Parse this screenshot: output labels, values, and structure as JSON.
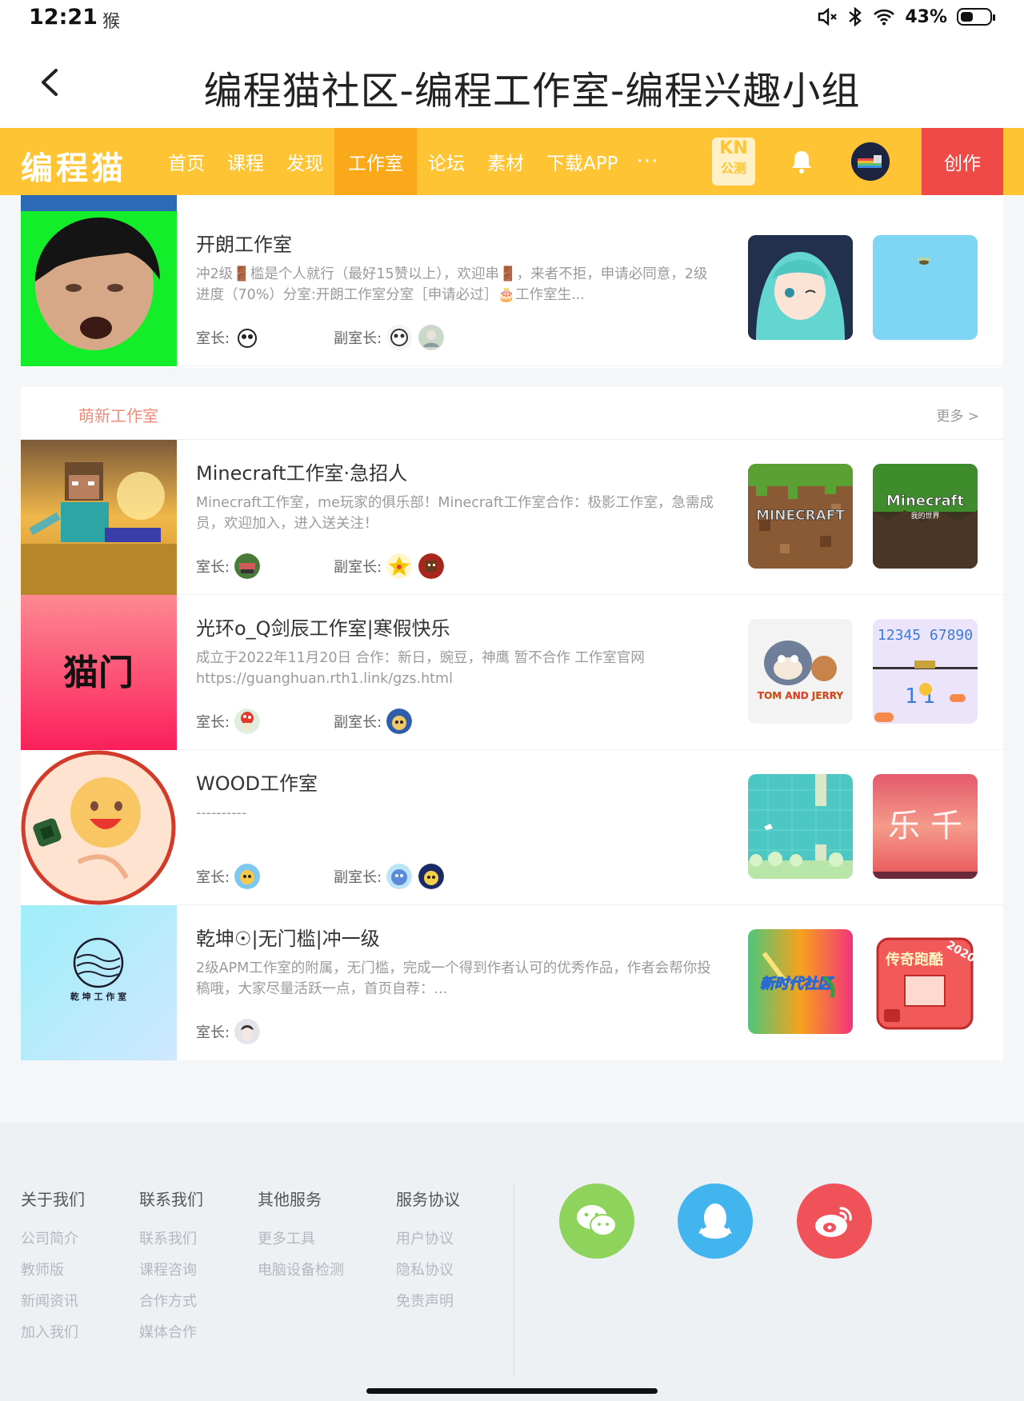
{
  "status_bar": {
    "time": "12:21",
    "app_glyph": "猴",
    "battery": "43%",
    "battery_level": 0.43
  },
  "header": {
    "title": "编程猫社区-编程工作室-编程兴趣小组"
  },
  "nav": {
    "logo": "编程猫",
    "items": [
      "首页",
      "课程",
      "发现",
      "工作室",
      "论坛",
      "素材",
      "下载APP"
    ],
    "active": "工作室",
    "more": "···",
    "badge_top": "KN",
    "badge_bottom": "公测",
    "create": "创作"
  },
  "top_studio": {
    "name": "开朗工作室",
    "desc": "冲2级🚪槛是个人就行（最好15赞以上），欢迎串🚪，来者不拒，申请必同意，2级进度（70%）分室:开朗工作室分室［申请必过］🎂工作室生...",
    "leader_label": "室长:",
    "vice_label": "副室长:"
  },
  "section": {
    "title": "萌新工作室",
    "more": "更多 >",
    "studios": [
      {
        "name": "Minecraft工作室·急招人",
        "desc": "Minecraft工作室，me玩家的俱乐部！Minecraft工作室合作：极影工作室，急需成员，欢迎加入，进入送关注！",
        "leader_label": "室长:",
        "vice_label": "副室长:",
        "work1_text": "MINECRAFT",
        "work2_text": "Minecraft",
        "work2_sub": "我的世界"
      },
      {
        "name": "光环o_Q剑辰工作室|寒假快乐",
        "desc": "成立于2022年11月20日 合作：新日，豌豆，神鹰 暂不合作 工作室官网 https://guanghuan.rth1.link/gzs.html",
        "leader_label": "室长:",
        "vice_label": "副室长:",
        "cover_text": "猫门",
        "work1_text": "TOM AND JERRY",
        "work2_text": "12345  67890"
      },
      {
        "name": "WOOD工作室",
        "desc": "----------",
        "leader_label": "室长:",
        "vice_label": "副室长:",
        "work2_text": "乐 千"
      },
      {
        "name": "乾坤☉|无门槛|冲一级",
        "desc": "2级APM工作室的附属，无门槛，完成一个得到作者认可的优秀作品，作者会帮你投稿哦，大家尽量活跃一点，首页自荐：...",
        "leader_label": "室长:",
        "cover_text": "乾 坤 工 作 室",
        "work1_text": "新时代社区",
        "work2_text": "传奇跑酷",
        "work2_sub": "2020"
      }
    ]
  },
  "footer": {
    "columns": [
      {
        "title": "关于我们",
        "links": [
          "公司简介",
          "教师版",
          "新闻资讯",
          "加入我们"
        ]
      },
      {
        "title": "联系我们",
        "links": [
          "联系我们",
          "课程咨询",
          "合作方式",
          "媒体合作"
        ]
      },
      {
        "title": "其他服务",
        "links": [
          "更多工具",
          "电脑设备检测"
        ]
      },
      {
        "title": "服务协议",
        "links": [
          "用户协议",
          "隐私协议",
          "免责声明"
        ]
      }
    ],
    "social": [
      {
        "name": "wechat",
        "color": "#8ed35c"
      },
      {
        "name": "qq",
        "color": "#43b5ee"
      },
      {
        "name": "weibo",
        "color": "#f0525a"
      }
    ]
  }
}
